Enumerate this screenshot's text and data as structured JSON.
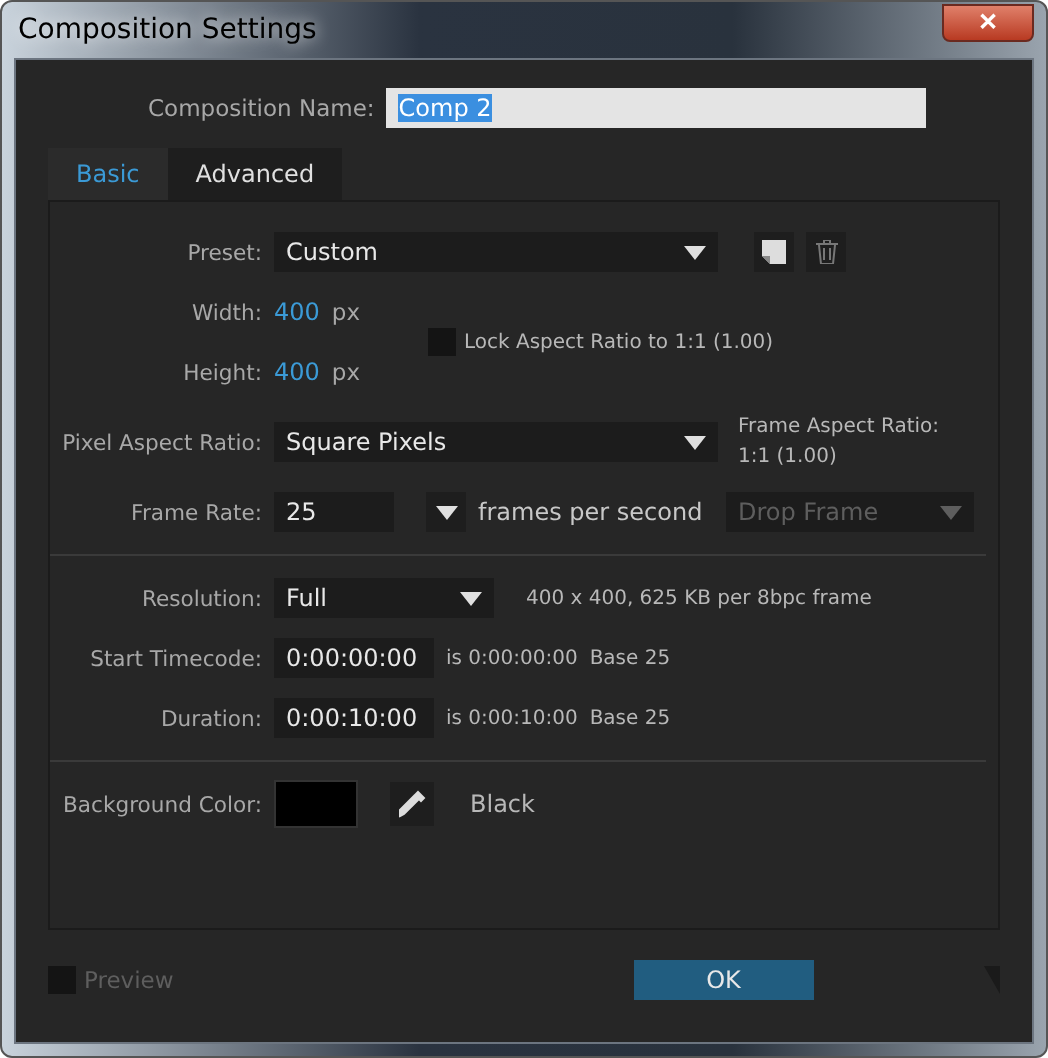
{
  "window": {
    "title": "Composition Settings",
    "close": "✕"
  },
  "composition_name": {
    "label": "Composition Name:",
    "value": "Comp 2",
    "highlighted": true
  },
  "tabs": [
    {
      "label": "Basic",
      "selected": true
    },
    {
      "label": "Advanced",
      "selected": false
    }
  ],
  "preset": {
    "label": "Preset:",
    "value": "Custom"
  },
  "width": {
    "label": "Width:",
    "value": "400",
    "unit": "px"
  },
  "height": {
    "label": "Height:",
    "value": "400",
    "unit": "px"
  },
  "lock_aspect": {
    "label": "Lock Aspect Ratio to 1:1 (1.00)",
    "checked": false
  },
  "pixel_aspect": {
    "label": "Pixel Aspect Ratio:",
    "value": "Square Pixels",
    "frame_aspect_label": "Frame Aspect Ratio:",
    "frame_aspect_value": "1:1 (1.00)"
  },
  "frame_rate": {
    "label": "Frame Rate:",
    "value": "25",
    "unit": "frames per second",
    "drop_frame": "Drop Frame",
    "drop_frame_disabled": true
  },
  "resolution": {
    "label": "Resolution:",
    "value": "Full",
    "info": "400 x 400, 625 KB per 8bpc frame"
  },
  "start_timecode": {
    "label": "Start Timecode:",
    "value": "0:00:00:00",
    "is": "is 0:00:00:00",
    "base": "Base 25"
  },
  "duration": {
    "label": "Duration:",
    "value": "0:00:10:00",
    "is": "is 0:00:10:00",
    "base": "Base 25"
  },
  "background": {
    "label": "Background Color:",
    "color": "#000000",
    "name": "Black"
  },
  "preview": {
    "label": "Preview",
    "checked": false,
    "disabled": true
  },
  "buttons": [
    "OK"
  ]
}
